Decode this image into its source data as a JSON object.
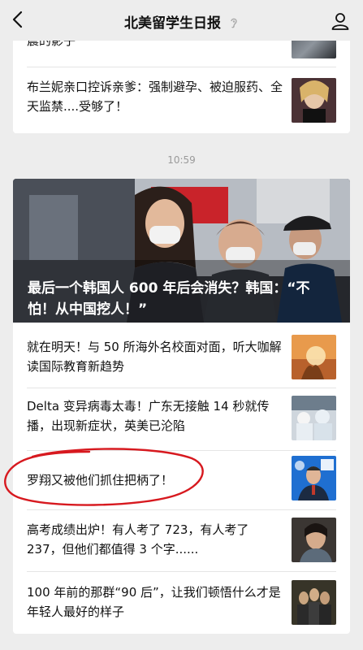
{
  "header": {
    "title": "北美留学生日报"
  },
  "top_card": {
    "partial_title": "震的影子",
    "item": {
      "title": "布兰妮亲口控诉亲爹：强制避孕、被迫服药、全天监禁....受够了！"
    }
  },
  "timestamp": "10:59",
  "hero": {
    "title": "最后一个韩国人 600 年后会消失？韩国：“不怕！从中国挖人！”"
  },
  "articles": [
    {
      "title": "就在明天！与 50 所海外名校面对面，听大咖解读国际教育新趋势"
    },
    {
      "title": "Delta 变异病毒太毒！广东无接触 14 秒就传播，出现新症状，英美已沦陷"
    },
    {
      "title": "罗翔又被他们抓住把柄了！"
    },
    {
      "title": "高考成绩出炉！有人考了 723，有人考了 237，但他们都值得 3 个字......"
    },
    {
      "title": "100 年前的那群“90 后”，让我们顿悟什么才是年轻人最好的样子"
    }
  ],
  "colors": {
    "background": "#ededed",
    "annotation": "#d7191f"
  }
}
